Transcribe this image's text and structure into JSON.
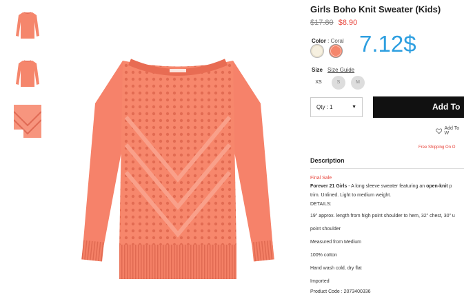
{
  "product": {
    "title": "Girls Boho Knit Sweater (Kids)",
    "old_price": "$17.80",
    "sale_price": "$8.90",
    "overlay_price": "7.12$",
    "color_label": "Color",
    "color_value": ": Coral",
    "size_label": "Size",
    "size_guide": "Size Guide",
    "sizes": [
      "XS",
      "S",
      "M"
    ],
    "qty_label": "Qty : 1",
    "add_button": "Add To",
    "wishlist": "Add To W",
    "shipping": "Free Shipping On O",
    "colors": [
      "#f3ebd8",
      "#f5866c"
    ]
  },
  "description": {
    "heading": "Description",
    "final_sale": "Final Sale",
    "brand_intro": "Forever 21 Girls",
    "intro_text": " - A long sleeve sweater featuring an ",
    "intro_bold": "open-knit",
    "intro_tail": " p",
    "line2": "trim. Unlined. Light to medium weight.",
    "details_label": "DETAILS:",
    "line4": "19\" approx. length from high point shoulder to hem, 32\" chest, 30\" u",
    "line5": "point shoulder",
    "line6": "Measured from Medium",
    "line7": "100% cotton",
    "line8": "Hand wash cold, dry flat",
    "line9": "Imported",
    "line10": "Product Code : 2073400336"
  }
}
